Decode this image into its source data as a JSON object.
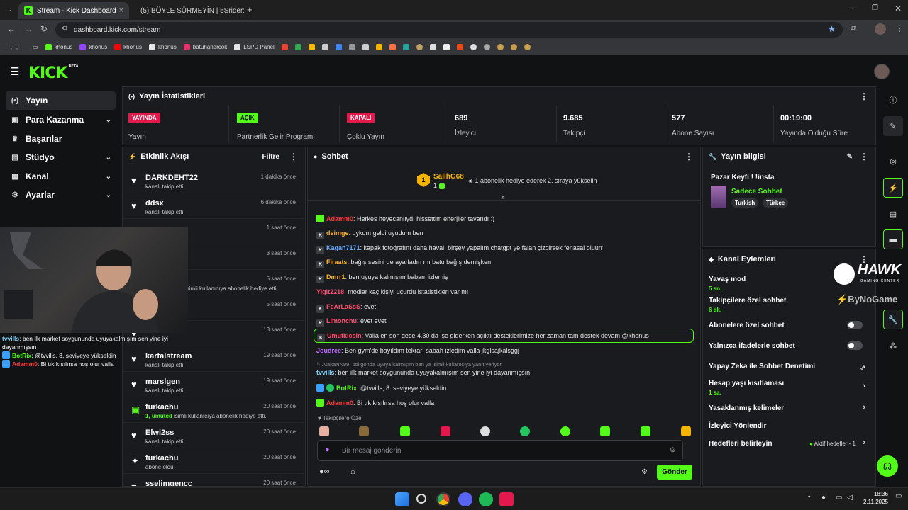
{
  "browser": {
    "tabs": [
      {
        "title": "Stream - Kick Dashboard",
        "active": true
      },
      {
        "title": "(5) BÖYLE SÜRMEYİN | 5Srider:",
        "active": false
      }
    ],
    "url": "dashboard.kick.com/stream",
    "bookmarks": [
      {
        "label": "khonus",
        "icon": "kick-icon",
        "color": "#53fc18"
      },
      {
        "label": "khonus",
        "icon": "twitch-icon",
        "color": "#9146ff"
      },
      {
        "label": "khonus",
        "icon": "youtube-icon",
        "color": "#ff0000"
      },
      {
        "label": "khonus",
        "icon": "x-icon",
        "color": "#e6e6e6"
      },
      {
        "label": "batuhanercok",
        "icon": "instagram-icon",
        "color": "#e1306c"
      },
      {
        "label": "LSPD Panel",
        "icon": "lspd-icon",
        "color": "#e6e6e6"
      }
    ]
  },
  "kick": {
    "logo": "KICK",
    "logo_sup": "BETA"
  },
  "sidebar": {
    "items": [
      {
        "label": "Yayın",
        "icon": "(•)",
        "active": true,
        "chevron": false
      },
      {
        "label": "Para Kazanma",
        "icon": "▣",
        "active": false,
        "chevron": true
      },
      {
        "label": "Başarılar",
        "icon": "🏆",
        "active": false,
        "chevron": false
      },
      {
        "label": "Stüdyo",
        "icon": "▤",
        "active": false,
        "chevron": true
      },
      {
        "label": "Kanal",
        "icon": "▦",
        "active": false,
        "chevron": true
      },
      {
        "label": "Ayarlar",
        "icon": "⚙",
        "active": false,
        "chevron": true
      }
    ]
  },
  "stats": {
    "title": "Yayın İstatistikleri",
    "cells": [
      {
        "badge": "YAYINDA",
        "badge_color": "red",
        "label": "Yayın"
      },
      {
        "badge": "AÇIK",
        "badge_color": "green",
        "label": "Partnerlik Gelir Programı"
      },
      {
        "badge": "KAPALI",
        "badge_color": "red",
        "label": "Çoklu Yayın"
      },
      {
        "value": "689",
        "label": "İzleyici"
      },
      {
        "value": "9.685",
        "label": "Takipçi"
      },
      {
        "value": "577",
        "label": "Abone Sayısı"
      },
      {
        "value": "00:19:00",
        "label": "Yayında Olduğu Süre"
      }
    ]
  },
  "activity": {
    "title": "Etkinlik Akışı",
    "filter": "Filtre",
    "items": [
      {
        "name": "DARKDEHT22",
        "sub": "kanalı takip etti",
        "time": "1 dakika önce",
        "icon": "heart"
      },
      {
        "name": "ddsx",
        "sub": "kanalı takip etti",
        "time": "6 dakika önce",
        "icon": "heart"
      },
      {
        "name": "",
        "sub": "",
        "time": "1 saat önce",
        "icon": "heart"
      },
      {
        "name": "",
        "sub": "",
        "time": "3 saat önce",
        "icon": "heart"
      },
      {
        "name": "",
        "sub": "isimli kullanıcıya abonelik hediye etti.",
        "time": "5 saat önce",
        "icon": "gift"
      },
      {
        "name": "",
        "sub": "",
        "time": "5 saat önce",
        "icon": "heart"
      },
      {
        "name": "",
        "sub": "",
        "time": "13 saat önce",
        "icon": "heart"
      },
      {
        "name": "kartalstream",
        "sub": "kanalı takip etti",
        "time": "19 saat önce",
        "icon": "heart"
      },
      {
        "name": "marslgen",
        "sub": "kanalı takip etti",
        "time": "19 saat önce",
        "icon": "heart"
      },
      {
        "name": "furkachu",
        "sub_green": "1, umutcd",
        "sub": "isimli kullanıcıya abonelik hediye etti.",
        "time": "20 saat önce",
        "icon": "gift"
      },
      {
        "name": "Elwi2ss",
        "sub": "kanalı takip etti",
        "time": "20 saat önce",
        "icon": "heart"
      },
      {
        "name": "furkachu",
        "sub": "abone oldu",
        "time": "20 saat önce",
        "icon": "star"
      },
      {
        "name": "sselimgencc",
        "sub": "",
        "time": "20 saat önce",
        "icon": "heart"
      }
    ]
  },
  "chat": {
    "title": "Sohbet",
    "pinned_user": "SalihG68",
    "pinned_level": "1",
    "pinned_rank": "1",
    "pinned_text": "1 abonelik hediye ederek 2. sıraya yükselin",
    "messages": [
      {
        "user": "Adamm0",
        "color": "#ff3b3b",
        "badges": [
          "bg"
        ],
        "text": "Herkes heyecanlıydı hissettim enerjiler tavandı :)"
      },
      {
        "user": "dsimge",
        "color": "#ffb020",
        "badges": [
          "bk"
        ],
        "text": "uykum geldi uyudum ben"
      },
      {
        "user": "Kagan7171",
        "color": "#6aa8ff",
        "badges": [
          "bk"
        ],
        "text": "kapak fotoğrafını daha havalı birşey yapalım chatgpt ye falan çizdirsek fenasal oluurr"
      },
      {
        "user": "Firaats",
        "color": "#ffb020",
        "badges": [
          "bk"
        ],
        "text": "bağış sesini de ayarladın mı batu bağış demişken"
      },
      {
        "user": "Dmrr1",
        "color": "#ffb020",
        "badges": [
          "bk"
        ],
        "text": "ben uyuya kalmışım babam izlemiş"
      },
      {
        "user": "Yigit2218",
        "color": "#ff4d6d",
        "badges": [],
        "text": "modlar kaç kişiyi uçurdu istatistikleri var mı"
      },
      {
        "user": "FeArLaSsS",
        "color": "#ff4d6d",
        "badges": [
          "bk"
        ],
        "text": "evet"
      },
      {
        "user": "Limonchu",
        "color": "#ff4d6d",
        "badges": [
          "bk"
        ],
        "text": "evet evet"
      },
      {
        "user": "Umutkicsin",
        "color": "#ff4d6d",
        "badges": [
          "bk"
        ],
        "text": "Valla en son gece 4.30 da işe giderken açıktı desteklerimize her zaman tam destek devam @khonus",
        "highlight": true
      },
      {
        "user": "Joudree",
        "color": "#c06bff",
        "badges": [],
        "text": "Ben gym'de bayıldım tekrarı sabah izledim valla jkglsajkalsggj"
      },
      {
        "user": "tvvills",
        "color": "#7fd1ff",
        "badges": [],
        "text": "ben ilk market soygununda uyuyakalmışım sen yine iyi dayanmışsın",
        "reply": "AtakaNN99: poligonda uyuya kalmışım ben ya isimli kullanıcıya yanıt veriyor"
      },
      {
        "user": "BotRix",
        "color": "#53fc18",
        "badges": [
          "bb",
          "bgr"
        ],
        "text": "@tvvills, 8. seviyeye yükseldin"
      },
      {
        "user": "Adamm0",
        "color": "#ff3b3b",
        "badges": [
          "bg"
        ],
        "text": "Bi tık kısılırsa hoş olur valla"
      }
    ],
    "followers_label": "Takipçilere Özel",
    "input_placeholder": "Bir mesaj gönderin",
    "send_label": "Gönder"
  },
  "overlay": {
    "messages": [
      {
        "user": "tvvills",
        "color": "#7fd1ff",
        "text": "ben ilk market soygununda uyuyakalmışım sen yine iyi dayanmışsın"
      },
      {
        "user": "BotRix",
        "color": "#53fc18",
        "text": "@tvvills, 8. seviyeye yükseldin"
      },
      {
        "user": "Adamm0",
        "color": "#ff3b3b",
        "text": "Bi tık kısılırsa hoş olur valla"
      }
    ],
    "hawk_title": "HAWK",
    "hawk_sub": "GAMING CENTER",
    "bynogame": "ByNoGame"
  },
  "stream_info": {
    "title": "Yayın bilgisi",
    "stream_title": "Pazar Keyfi ! !insta",
    "category": "Sadece Sohbet",
    "tags": [
      "Turkish",
      "Türkçe"
    ]
  },
  "channel_actions": {
    "title": "Kanal Eylemleri",
    "items": [
      {
        "label": "Yavaş mod",
        "sub": "5 sn."
      },
      {
        "label": "Takipçilere özel sohbet",
        "sub": "6 dk."
      },
      {
        "label": "Abonelere özel sohbet",
        "toggle": true
      },
      {
        "label": "Yalnızca ifadelerle sohbet",
        "toggle": true
      },
      {
        "label": "Yapay Zeka ile Sohbet Denetimi"
      },
      {
        "label": "Hesap yaşı kısıtlaması",
        "sub": "1 sa.",
        "arrow": true
      },
      {
        "label": "Yasaklanmış kelimeler",
        "arrow": true
      },
      {
        "label": "İzleyici Yönlendir"
      },
      {
        "label": "Hedefleri belirleyin",
        "right_text": "Aktif hedefler - 1",
        "arrow": true
      }
    ]
  },
  "taskbar": {
    "time": "18:36",
    "date": "2.11.2025"
  }
}
